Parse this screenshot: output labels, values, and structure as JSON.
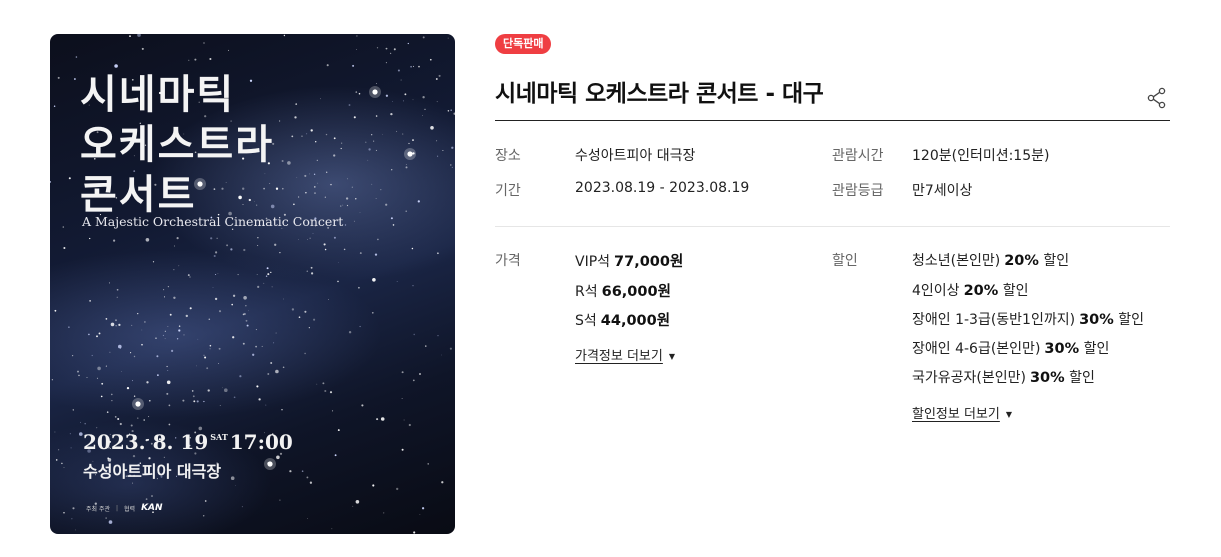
{
  "poster": {
    "title_lines": [
      "시네마틱",
      "오케스트라",
      "콘서트"
    ],
    "subtitle": "A Majestic Orchestral Cinematic Concert",
    "date": "2023. 8. 19",
    "day": "SAT",
    "time": "17:00",
    "venue": "수성아트피아 대극장",
    "credits": [
      "주최 주관",
      "협력",
      "KAN"
    ]
  },
  "badge": "단독판매",
  "title": "시네마틱 오케스트라 콘서트 - 대구",
  "info": {
    "venue_label": "장소",
    "venue": "수성아트피아 대극장",
    "period_label": "기간",
    "period": "2023.08.19 - 2023.08.19",
    "runtime_label": "관람시간",
    "runtime": "120분(인터미션:15분)",
    "rating_label": "관람등급",
    "rating": "만7세이상"
  },
  "price": {
    "label": "가격",
    "rows": [
      {
        "seat": "VIP석",
        "amount": "77,000원"
      },
      {
        "seat": "R석",
        "amount": "66,000원"
      },
      {
        "seat": "S석",
        "amount": "44,000원"
      }
    ],
    "more": "가격정보 더보기"
  },
  "discount": {
    "label": "할인",
    "rows": [
      {
        "name": "청소년(본인만)",
        "rate": "20%",
        "suffix": "할인"
      },
      {
        "name": "4인이상",
        "rate": "20%",
        "suffix": "할인"
      },
      {
        "name": "장애인 1-3급(동반1인까지)",
        "rate": "30%",
        "suffix": "할인"
      },
      {
        "name": "장애인 4-6급(본인만)",
        "rate": "30%",
        "suffix": "할인"
      },
      {
        "name": "국가유공자(본인만)",
        "rate": "30%",
        "suffix": "할인"
      }
    ],
    "more": "할인정보 더보기"
  },
  "icons": {
    "share": "share-icon",
    "caret": "caret-down-icon"
  },
  "colors": {
    "badge": "#ef3e42",
    "text": "#222222",
    "label": "#666666"
  }
}
